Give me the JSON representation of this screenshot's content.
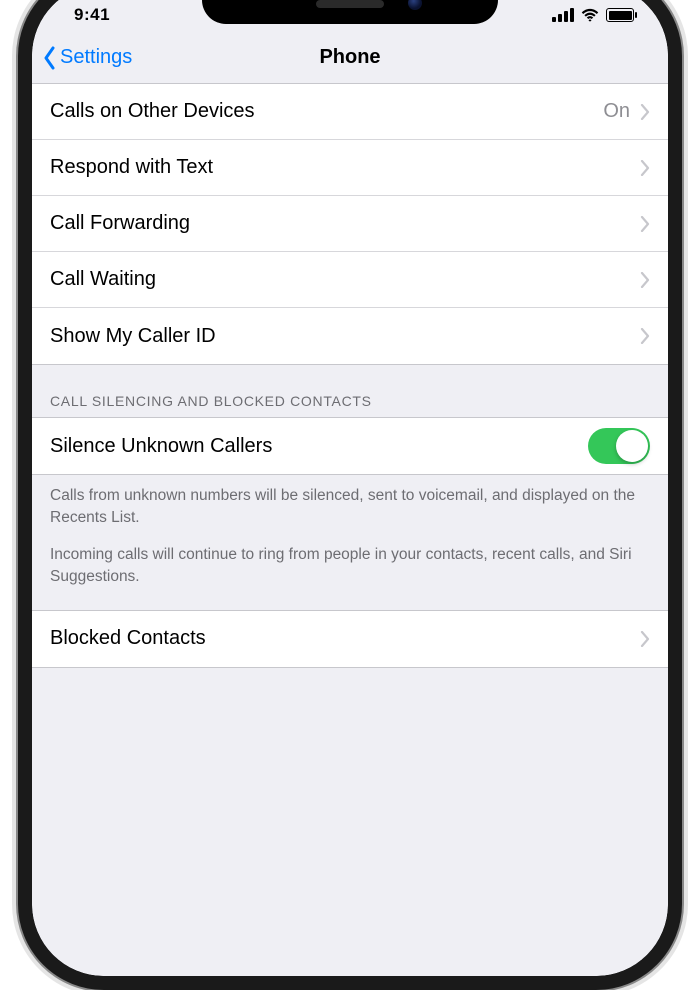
{
  "status": {
    "time": "9:41"
  },
  "nav": {
    "back_label": "Settings",
    "title": "Phone"
  },
  "rows": {
    "calls_other": {
      "label": "Calls on Other Devices",
      "value": "On"
    },
    "respond_text": {
      "label": "Respond with Text"
    },
    "call_forwarding": {
      "label": "Call Forwarding"
    },
    "call_waiting": {
      "label": "Call Waiting"
    },
    "caller_id": {
      "label": "Show My Caller ID"
    },
    "silence_unknown": {
      "label": "Silence Unknown Callers",
      "toggle": true
    },
    "blocked_contacts": {
      "label": "Blocked Contacts"
    }
  },
  "sections": {
    "silencing_header": "CALL SILENCING AND BLOCKED CONTACTS",
    "silencing_footer_1": "Calls from unknown numbers will be silenced, sent to voicemail, and displayed on the Recents List.",
    "silencing_footer_2": "Incoming calls will continue to ring from people in your contacts, recent calls, and Siri Suggestions."
  }
}
